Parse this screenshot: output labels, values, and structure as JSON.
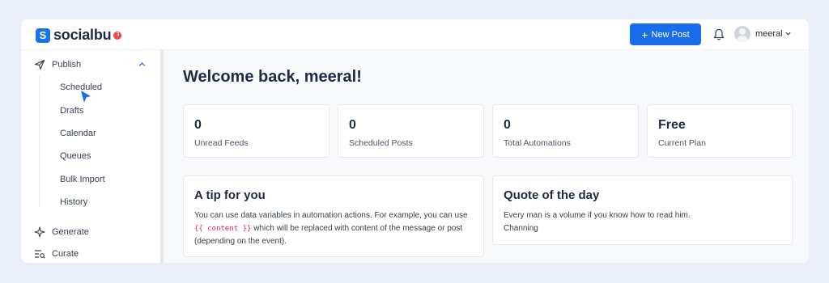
{
  "header": {
    "brand": "socialbu",
    "badge_count": "3",
    "new_post_label": "New Post",
    "username": "meeral"
  },
  "sidebar": {
    "publish_label": "Publish",
    "items": [
      {
        "label": "Scheduled"
      },
      {
        "label": "Drafts"
      },
      {
        "label": "Calendar"
      },
      {
        "label": "Queues"
      },
      {
        "label": "Bulk Import"
      },
      {
        "label": "History"
      }
    ],
    "generate_label": "Generate",
    "curate_label": "Curate"
  },
  "main": {
    "welcome": "Welcome back, meeral!",
    "stats": [
      {
        "value": "0",
        "label": "Unread Feeds"
      },
      {
        "value": "0",
        "label": "Scheduled Posts"
      },
      {
        "value": "0",
        "label": "Total Automations"
      },
      {
        "value": "Free",
        "label": "Current Plan"
      }
    ],
    "tip": {
      "title": "A tip for you",
      "text_before": "You can use data variables in automation actions. For example, you can use",
      "code": "{{ content }}",
      "text_after": "which will be replaced with content of the message or post (depending on the event)."
    },
    "quote": {
      "title": "Quote of the day",
      "text": "Every man is a volume if you know how to read him.",
      "author": "Channing"
    }
  },
  "colors": {
    "accent": "#1a6dea",
    "badge": "#ef4444",
    "background": "#e9eef8"
  },
  "icons": [
    "send-icon",
    "chevron-up-icon",
    "sparkle-icon",
    "curate-icon",
    "bell-icon",
    "chevron-down-icon",
    "plus-icon",
    "cursor-icon"
  ]
}
